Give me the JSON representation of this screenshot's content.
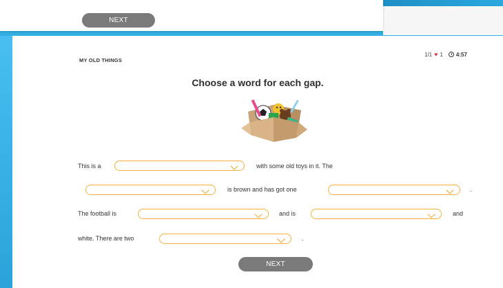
{
  "top": {
    "next_label": "NEXT"
  },
  "header": {
    "section": "MY OLD THINGS",
    "progress": "1/1",
    "lives": "1",
    "timer": "4:57"
  },
  "question": {
    "title": "Choose a word for each gap."
  },
  "text": {
    "t1": "This is a",
    "t2": "with some old toys in it. The",
    "t3": "is brown and has got one",
    "t4": ".",
    "t5": "The football is",
    "t6": "and is",
    "t7": "and",
    "t8": "white. There are two",
    "t9": "."
  },
  "gaps": [
    {
      "value": ""
    },
    {
      "value": ""
    },
    {
      "value": ""
    },
    {
      "value": ""
    },
    {
      "value": ""
    },
    {
      "value": ""
    }
  ],
  "footer": {
    "next_label": "NEXT"
  },
  "colors": {
    "accent": "#f3b13a",
    "button": "#7a7a7a",
    "heart": "#e53a47",
    "background": "#3cb6e8"
  }
}
